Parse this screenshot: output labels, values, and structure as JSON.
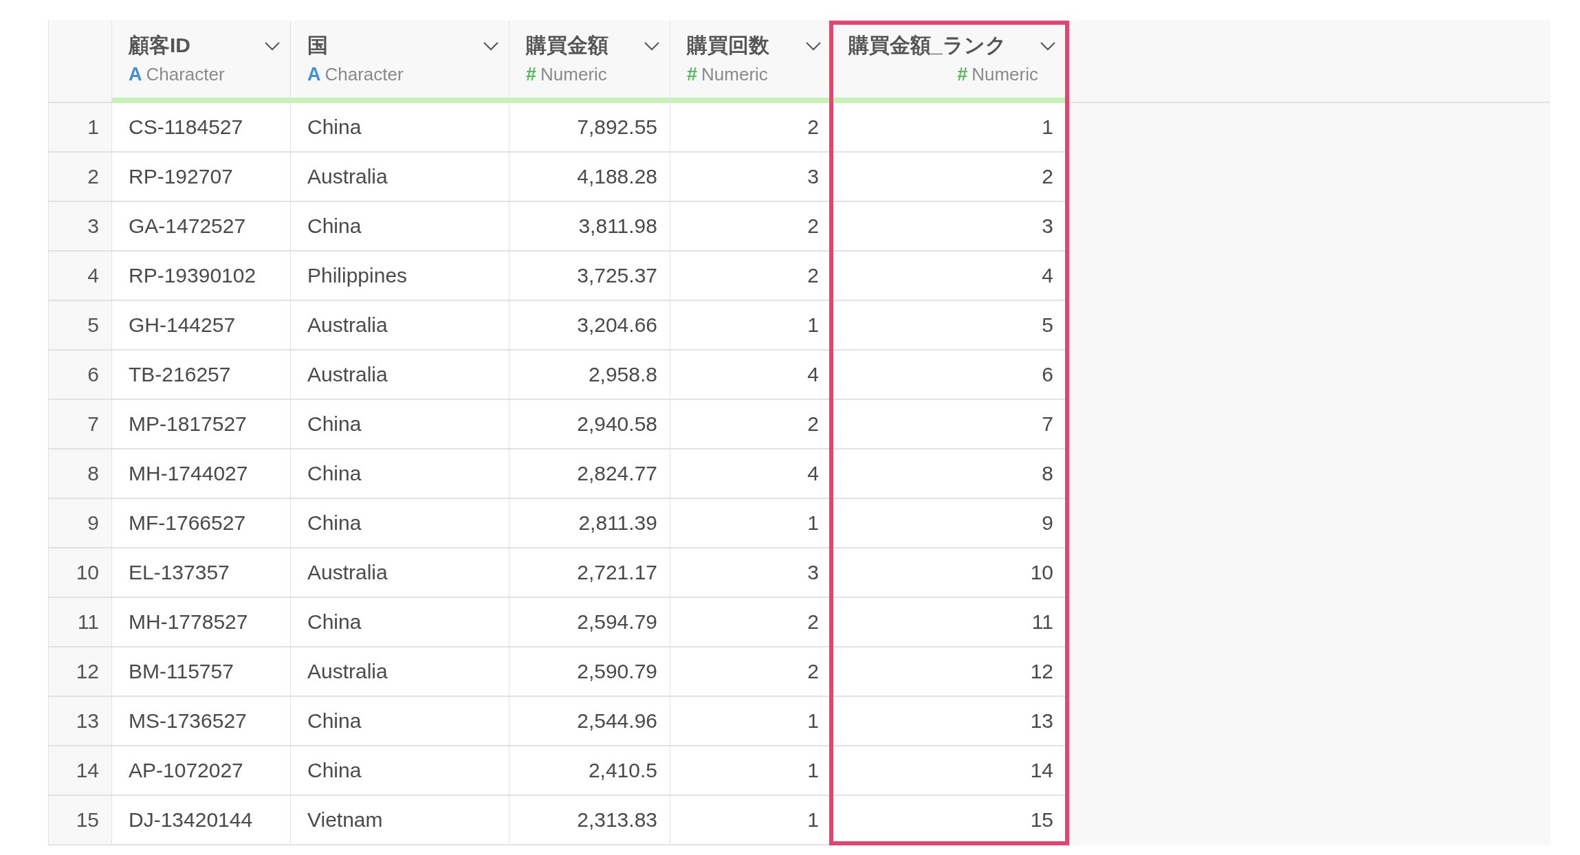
{
  "table": {
    "columns": [
      {
        "name": "顧客ID",
        "type": "Character",
        "type_mark": "A",
        "kind": "character",
        "highlighted": false
      },
      {
        "name": "国",
        "type": "Character",
        "type_mark": "A",
        "kind": "character",
        "highlighted": false
      },
      {
        "name": "購買金額",
        "type": "Numeric",
        "type_mark": "#",
        "kind": "numeric",
        "highlighted": false
      },
      {
        "name": "購買回数",
        "type": "Numeric",
        "type_mark": "#",
        "kind": "numeric",
        "highlighted": false
      },
      {
        "name": "購買金額_ランク",
        "type": "Numeric",
        "type_mark": "#",
        "kind": "numeric",
        "highlighted": true
      }
    ],
    "rows": [
      {
        "number": "1",
        "cells": [
          "CS-1184527",
          "China",
          "7,892.55",
          "2",
          "1"
        ]
      },
      {
        "number": "2",
        "cells": [
          "RP-192707",
          "Australia",
          "4,188.28",
          "3",
          "2"
        ]
      },
      {
        "number": "3",
        "cells": [
          "GA-1472527",
          "China",
          "3,811.98",
          "2",
          "3"
        ]
      },
      {
        "number": "4",
        "cells": [
          "RP-19390102",
          "Philippines",
          "3,725.37",
          "2",
          "4"
        ]
      },
      {
        "number": "5",
        "cells": [
          "GH-144257",
          "Australia",
          "3,204.66",
          "1",
          "5"
        ]
      },
      {
        "number": "6",
        "cells": [
          "TB-216257",
          "Australia",
          "2,958.8",
          "4",
          "6"
        ]
      },
      {
        "number": "7",
        "cells": [
          "MP-1817527",
          "China",
          "2,940.58",
          "2",
          "7"
        ]
      },
      {
        "number": "8",
        "cells": [
          "MH-1744027",
          "China",
          "2,824.77",
          "4",
          "8"
        ]
      },
      {
        "number": "9",
        "cells": [
          "MF-1766527",
          "China",
          "2,811.39",
          "1",
          "9"
        ]
      },
      {
        "number": "10",
        "cells": [
          "EL-137357",
          "Australia",
          "2,721.17",
          "3",
          "10"
        ]
      },
      {
        "number": "11",
        "cells": [
          "MH-1778527",
          "China",
          "2,594.79",
          "2",
          "11"
        ]
      },
      {
        "number": "12",
        "cells": [
          "BM-115757",
          "Australia",
          "2,590.79",
          "2",
          "12"
        ]
      },
      {
        "number": "13",
        "cells": [
          "MS-1736527",
          "China",
          "2,544.96",
          "1",
          "13"
        ]
      },
      {
        "number": "14",
        "cells": [
          "AP-1072027",
          "China",
          "2,410.5",
          "1",
          "14"
        ]
      },
      {
        "number": "15",
        "cells": [
          "DJ-13420144",
          "Vietnam",
          "2,313.83",
          "1",
          "15"
        ]
      }
    ]
  }
}
